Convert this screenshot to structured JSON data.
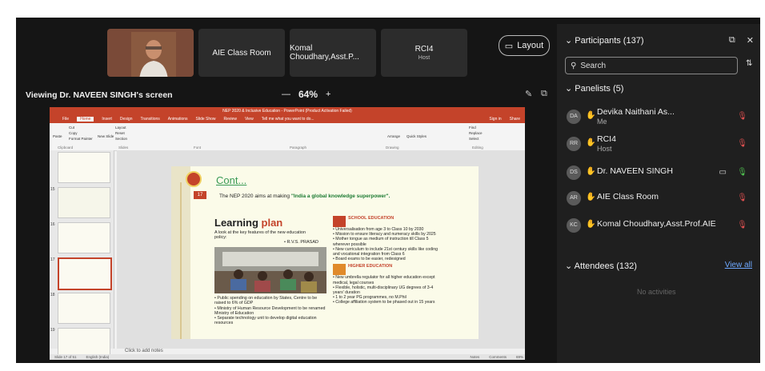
{
  "tiles": [
    {
      "label": "AIE Class Room",
      "sub": ""
    },
    {
      "label": "Komal Choudhary,Asst.P...",
      "sub": ""
    },
    {
      "label": "RCI4",
      "sub": "Host"
    }
  ],
  "layout_button": "Layout",
  "viewing_label": "Viewing Dr. NAVEEN SINGH's screen",
  "zoom": {
    "minus": "—",
    "level": "64%",
    "plus": "+"
  },
  "ppt": {
    "title": "NEP 2020 & Inclusive Education - PowerPoint (Product Activation Failed)",
    "menu": [
      "File",
      "Home",
      "Insert",
      "Design",
      "Transitions",
      "Animations",
      "Slide Show",
      "Review",
      "View",
      "Tell me what you want to do..."
    ],
    "ribbon_groups": [
      "Clipboard",
      "Slides",
      "Font",
      "Paragraph",
      "Drawing",
      "Editing"
    ],
    "ribbon_items": {
      "cut": "Cut",
      "copy": "Copy",
      "format_painter": "Format Painter",
      "paste": "Paste",
      "new_slide": "New Slide",
      "layout": "Layout",
      "reset": "Reset",
      "section": "Section",
      "arrange": "Arrange",
      "quick_styles": "Quick Styles",
      "find": "Find",
      "replace": "Replace",
      "select": "Select",
      "sign_in": "Sign in",
      "share": "Share"
    },
    "thumb_numbers": [
      "15",
      "16",
      "17",
      "18",
      "19"
    ],
    "notes": "Click to add notes",
    "status": {
      "slide": "Slide 17 of 51",
      "lang": "English (India)",
      "notes_btn": "Notes",
      "comments_btn": "Comments",
      "zoom": "69%"
    }
  },
  "slide": {
    "number": "17",
    "cont": "Cont...",
    "nep_line_pre": "The NEP 2020 aims at making ",
    "nep_line_bold": "\"India a global knowledge superpower\".",
    "lp_title_1": "Learning ",
    "lp_title_2": "plan",
    "lp_sub": "A look at the key features of the new education policy:",
    "lp_credit": "• R.V.S. PRASAD",
    "left_points": [
      "• Public spending on education by States, Centre to be raised to 6% of GDP",
      "• Ministry of Human Resource Development to be renamed Ministry of Education",
      "• Separate technology unit to develop digital education resources"
    ],
    "school_head": "SCHOOL EDUCATION",
    "school_points": [
      "• Universalisation from age 3 to Class 10 by 2030",
      "• Mission to ensure literacy and numeracy skills by 2025",
      "• Mother tongue as medium of instruction till Class 5 wherever possible",
      "• New curriculum to include 21st century skills like coding and vocational integration from Class 6",
      "• Board exams to be easier, redesigned"
    ],
    "higher_head": "HIGHER EDUCATION",
    "higher_points": [
      "• New umbrella regulator for all higher education except medical, legal courses",
      "• Flexible, holistic, multi-disciplinary UG degrees of 3-4 years' duration",
      "• 1 to 2 year PG programmes, no M.Phil",
      "• College affiliation system to be phased out in 15 years"
    ]
  },
  "panel": {
    "participants_title": "Participants (137)",
    "search_placeholder": "Search",
    "panelists_title": "Panelists (5)",
    "panelists": [
      {
        "initials": "DA",
        "name": "Devika Naithani As...",
        "role": "Me"
      },
      {
        "initials": "RR",
        "name": "RCI4",
        "role": "Host"
      },
      {
        "initials": "DS",
        "name": "Dr. NAVEEN SINGH",
        "role": ""
      },
      {
        "initials": "AR",
        "name": "AIE Class Room",
        "role": ""
      },
      {
        "initials": "KC",
        "name": "Komal Choudhary,Asst.Prof.AIE",
        "role": ""
      }
    ],
    "attendees_title": "Attendees (132)",
    "view_all": "View all",
    "no_activities": "No activities"
  }
}
